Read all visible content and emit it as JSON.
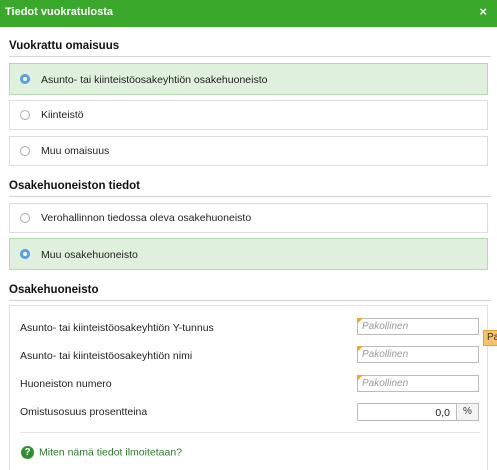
{
  "dialog": {
    "title": "Tiedot vuokratulosta",
    "close_icon": "×"
  },
  "sections": {
    "property": {
      "heading": "Vuokrattu omaisuus",
      "options": [
        {
          "label": "Asunto- tai kiinteistöosakeyhtiön osakehuoneisto",
          "selected": true
        },
        {
          "label": "Kiinteistö",
          "selected": false
        },
        {
          "label": "Muu omaisuus",
          "selected": false
        }
      ]
    },
    "apartment_info": {
      "heading": "Osakehuoneiston tiedot",
      "options": [
        {
          "label": "Verohallinnon tiedossa oleva osakehuoneisto",
          "selected": false
        },
        {
          "label": "Muu osakehuoneisto",
          "selected": true
        }
      ]
    },
    "apartment": {
      "heading": "Osakehuoneisto",
      "fields": [
        {
          "label": "Asunto- tai kiinteistöosakeyhtiön Y-tunnus",
          "placeholder": "Pakollinen",
          "value": ""
        },
        {
          "label": "Asunto- tai kiinteistöosakeyhtiön nimi",
          "placeholder": "Pakollinen",
          "value": ""
        },
        {
          "label": "Huoneiston numero",
          "placeholder": "Pakollinen",
          "value": ""
        }
      ],
      "ownership": {
        "label": "Omistusosuus prosentteina",
        "value": "0,0",
        "unit": "%"
      },
      "tooltip_text": "Pa"
    }
  },
  "help_link": {
    "icon": "?",
    "text": "Miten nämä tiedot ilmoitetaan?"
  },
  "colors": {
    "titlebar": "#3aa82a",
    "selected_bg": "#dff0dc",
    "radio_on": "#5aa0e6",
    "required_marker": "#f5a623"
  }
}
